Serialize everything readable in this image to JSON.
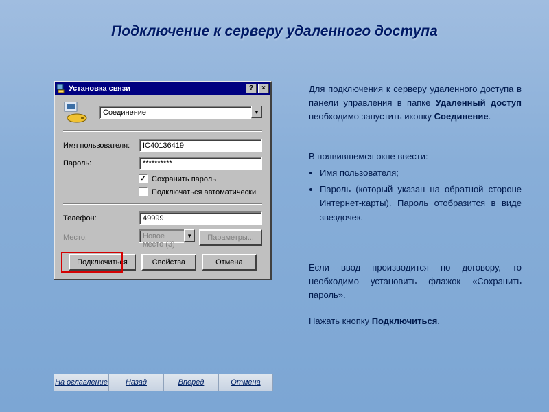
{
  "slide": {
    "title": "Подключение к серверу удаленного доступа"
  },
  "dialog": {
    "title": "Установка связи",
    "connection_name": "Соединение",
    "labels": {
      "username": "Имя пользователя:",
      "password": "Пароль:",
      "save_pw": "Сохранить пароль",
      "auto_connect": "Подключаться автоматически",
      "phone": "Телефон:",
      "place": "Место:"
    },
    "values": {
      "username": "IC40136419",
      "password": "**********",
      "phone": "49999",
      "place": "Новое место (3)"
    },
    "buttons": {
      "params": "Параметры...",
      "connect": "Подключиться",
      "props": "Свойства",
      "cancel": "Отмена"
    },
    "titlebar": {
      "help": "?",
      "close": "×"
    }
  },
  "text": {
    "p1a": "Для подключения к серверу удаленного доступа в панели управления в папке ",
    "p1b": "Удаленный доступ",
    "p1c": " необходимо запустить иконку ",
    "p1d": "Соединение",
    "p1e": ".",
    "p2": "В появившемся окне ввести:",
    "li1": "Имя пользователя;",
    "li2": "Пароль (который указан на обратной стороне Интернет-карты). Пароль отобразится в виде звездочек.",
    "p3a": "Если ввод производится по договору, то необходимо установить флажок «Сохранить пароль».",
    "p4a": "Нажать кнопку ",
    "p4b": "Подключиться",
    "p4c": "."
  },
  "nav": {
    "toc": "На оглавление",
    "back": "Назад",
    "fwd": "Вперед",
    "cancel": "Отмена"
  }
}
